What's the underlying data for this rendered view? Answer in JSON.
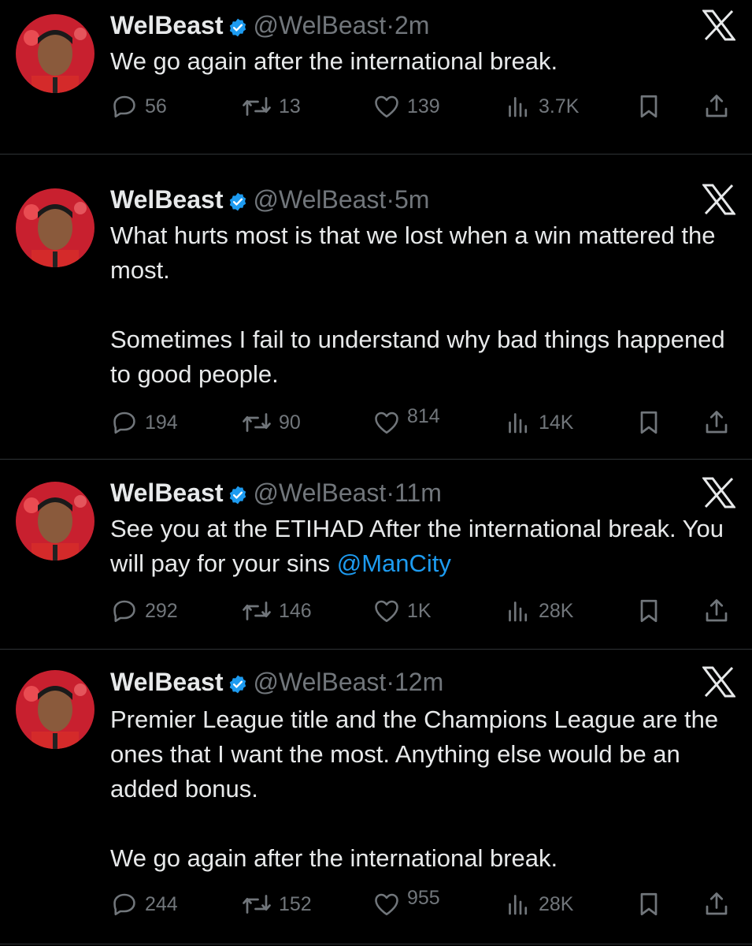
{
  "colors": {
    "background": "#000000",
    "text": "#e7e9ea",
    "muted": "#71767b",
    "link": "#1d9bf0",
    "verified": "#1d9bf0",
    "divider": "#2f3336"
  },
  "icons": {
    "reply": "speech-bubble-icon",
    "retweet": "retweet-arrows-icon",
    "like": "heart-icon",
    "views": "bar-chart-icon",
    "bookmark": "bookmark-icon",
    "share": "share-upload-icon",
    "brand": "x-logo-icon",
    "verified": "verified-badge-icon"
  },
  "tweets": [
    {
      "name": "WelBeast",
      "handle": "@WelBeast",
      "sep": "·",
      "time": "2m",
      "paragraphs": [
        "We go again after the international break."
      ],
      "replies": "56",
      "retweets": "13",
      "likes": "139",
      "views": "3.7K"
    },
    {
      "name": "WelBeast",
      "handle": "@WelBeast",
      "sep": "·",
      "time": "5m",
      "paragraphs": [
        "What hurts most is that we lost when a win mattered the most.",
        "Sometimes I fail to understand why bad things happened to good people."
      ],
      "replies": "194",
      "retweets": "90",
      "likes": "814",
      "views": "14K"
    },
    {
      "name": "WelBeast",
      "handle": "@WelBeast",
      "sep": "·",
      "time": "11m",
      "text_before_mention": "See you at the ETIHAD After the international break. You will pay for your sins ",
      "mention": "@ManCity",
      "replies": "292",
      "retweets": "146",
      "likes": "1K",
      "views": "28K"
    },
    {
      "name": "WelBeast",
      "handle": "@WelBeast",
      "sep": "·",
      "time": "12m",
      "paragraphs": [
        "Premier League title and the Champions League are the ones that I want the most. Anything else would be an added bonus.",
        "We go again after the international break."
      ],
      "replies": "244",
      "retweets": "152",
      "likes": "955",
      "views": "28K"
    }
  ]
}
